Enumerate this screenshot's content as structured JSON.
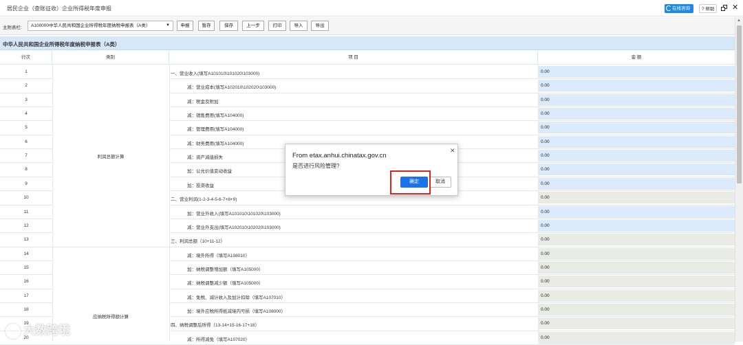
{
  "window": {
    "title": "居民企业（查账征收）企业所得税年度申报",
    "online_label": "在线咨询",
    "help_label": "? 帮助"
  },
  "toolbar": {
    "table_label": "主附表栏:",
    "selected_table": "A100000中华人民共和国企业所得税年度纳税申报表（A类）",
    "buttons": [
      "申报",
      "暂存",
      "保存",
      "上一步",
      "打印",
      "导入",
      "导出"
    ]
  },
  "section_title": "中华人民共和国企业所得税年度纳税申报表（A类）",
  "headers": {
    "row_no": "行次",
    "category": "类别",
    "item": "项 目",
    "amount": "金 额"
  },
  "categories": [
    {
      "label": "利润总额计算"
    },
    {
      "label": "应纳税所得额计算"
    }
  ],
  "rows": [
    {
      "no": "1",
      "item": "一、营业收入(填写A101010\\101020\\103000)",
      "amount": "0.00",
      "editable": true
    },
    {
      "no": "2",
      "item": "减：营业成本(填写A102010\\102020\\103000)",
      "amount": "0.00",
      "editable": true
    },
    {
      "no": "3",
      "item": "减：税金及附加",
      "amount": "0.00",
      "editable": true
    },
    {
      "no": "4",
      "item": "减：销售费用(填写A104000)",
      "amount": "0.00",
      "editable": true
    },
    {
      "no": "5",
      "item": "减：管理费用(填写A104000)",
      "amount": "0.00",
      "editable": true
    },
    {
      "no": "6",
      "item": "减：财务费用(填写A104000)",
      "amount": "0.00",
      "editable": true
    },
    {
      "no": "7",
      "item": "减：资产减值损失",
      "amount": "0.00",
      "editable": true
    },
    {
      "no": "8",
      "item": "加：公允价值变动收益",
      "amount": "0.00",
      "editable": true
    },
    {
      "no": "9",
      "item": "加：投资收益",
      "amount": "0.00",
      "editable": true
    },
    {
      "no": "10",
      "item": "二、营业利润(1-2-3-4-5-6-7+8+9)",
      "amount": "0.00",
      "editable": false
    },
    {
      "no": "11",
      "item": "加：营业外收入(填写A101010\\101020\\103000)",
      "amount": "0.00",
      "editable": true
    },
    {
      "no": "12",
      "item": "减：营业外支出(填写A102010\\102020\\103000)",
      "amount": "0.00",
      "editable": true
    },
    {
      "no": "13",
      "item": "三、利润总额（10+11-12）",
      "amount": "0.00",
      "editable": false
    },
    {
      "no": "14",
      "item": "减：境外所得（填写A108010）",
      "amount": "0.00",
      "editable": false
    },
    {
      "no": "15",
      "item": "加：纳税调整增加额（填写A105000）",
      "amount": "0.00",
      "editable": false
    },
    {
      "no": "16",
      "item": "减：纳税调整减少额（填写A105000）",
      "amount": "0.00",
      "editable": false
    },
    {
      "no": "17",
      "item": "减：免税、减计收入及加计扣除（填写A107010）",
      "amount": "0.00",
      "editable": false
    },
    {
      "no": "18",
      "item": "加：境外应税所得抵减境内亏损（填写A108000）",
      "amount": "0.00",
      "editable": false
    },
    {
      "no": "19",
      "item": "四、纳税调整后所得（13-14+15-16-17+18）",
      "amount": "0.00",
      "editable": false
    },
    {
      "no": "20",
      "item": "减：所得减免（填写A107020）",
      "amount": "0.00",
      "editable": false
    }
  ],
  "dialog": {
    "source": "From etax.anhui.chinatax.gov.cn",
    "message": "是否进行风险管理?",
    "ok_label": "确定",
    "cancel_label": "取消"
  },
  "watermark": "大数跨境",
  "colors": {
    "editable_cell": "#dcebfb",
    "readonly_cell": "#ebebe5",
    "section_bg": "#d6e7f8",
    "primary_button": "#1a73e8",
    "highlight_box": "#e0201c"
  }
}
